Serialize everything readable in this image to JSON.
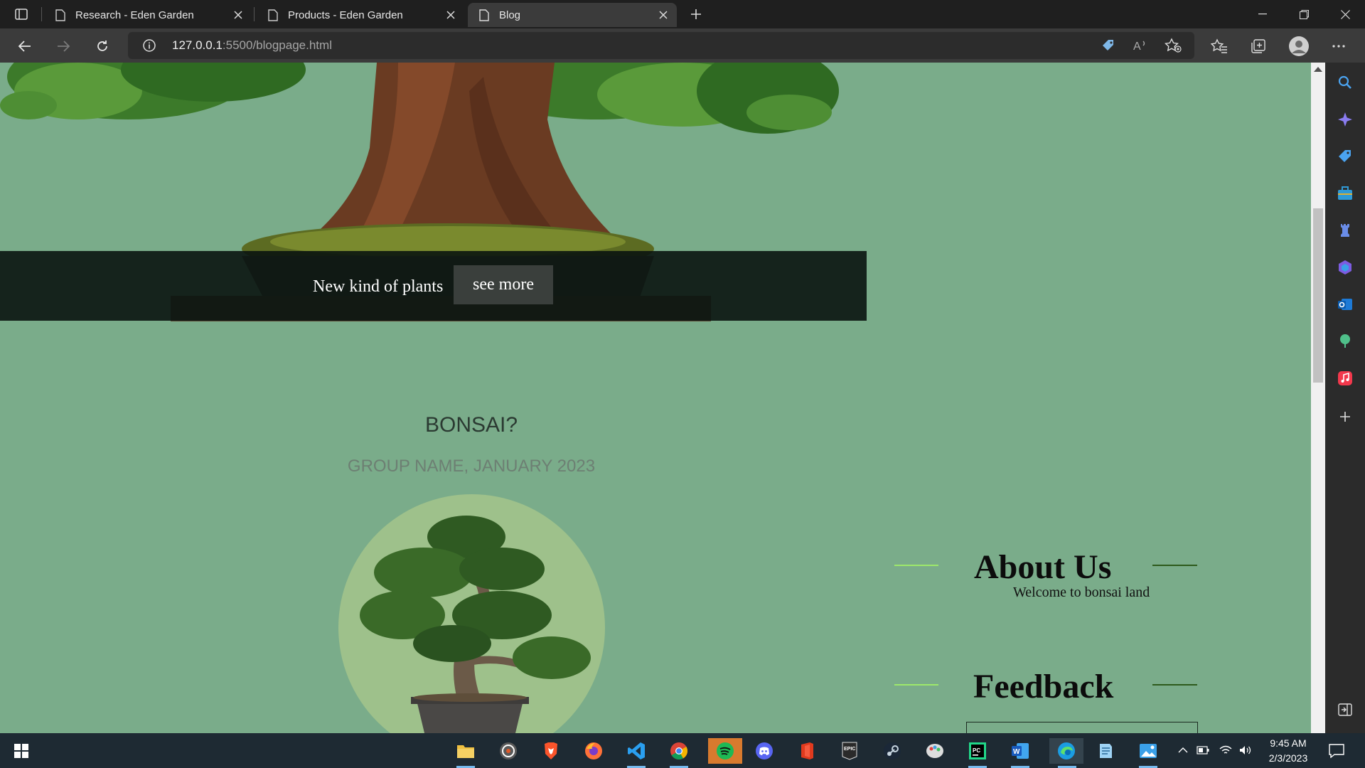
{
  "browser": {
    "tabs": [
      {
        "label": "Research - Eden Garden"
      },
      {
        "label": "Products - Eden Garden"
      },
      {
        "label": "Blog"
      }
    ],
    "url_host": "127.0.0.1",
    "url_path": ":5500/blogpage.html"
  },
  "hero": {
    "caption": "New kind of plants",
    "button": "see more"
  },
  "article": {
    "title": "BONSAI?",
    "meta": "GROUP NAME, JANUARY 2023"
  },
  "aside": {
    "about_title": "About Us",
    "about_text": "Welcome to bonsai land",
    "feedback_title": "Feedback"
  },
  "taskbar": {
    "time": "9:45 AM",
    "date": "2/3/2023"
  },
  "colors": {
    "page_bg": "#7aac8a",
    "caption_bg": "#0a1410",
    "circle_bg": "#9ec18b",
    "accent_line_left": "#9ee86b",
    "accent_line_right": "#2d5a1c"
  }
}
